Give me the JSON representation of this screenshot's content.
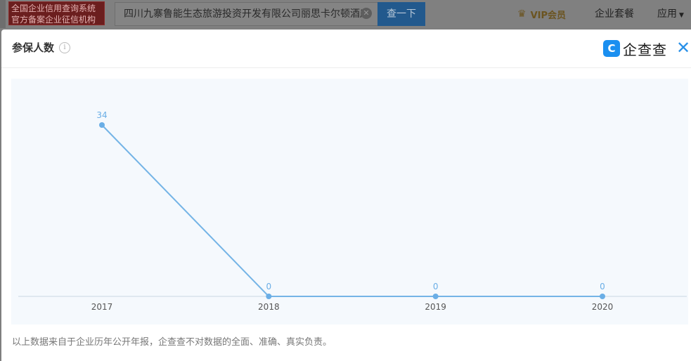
{
  "topbar": {
    "brand_line1": "全国企业信用查询系统",
    "brand_line2": "官方备案企业征信机构",
    "search_value": "四川九寨鲁能生态旅游投资开发有限公司丽思卡尔顿酒店",
    "search_button": "查一下",
    "vip_label": "VIP会员",
    "package_label": "企业套餐",
    "app_label": "应用"
  },
  "modal": {
    "title": "参保人数",
    "logo_text": "企查查",
    "footnote": "以上数据来自于企业历年公开年报，企查查不对数据的全面、准确、真实负责。"
  },
  "icons": {
    "info": "info-icon",
    "close": "close-icon",
    "clear": "clear-icon",
    "crown": "crown-icon",
    "logo": "qichacha-logo-icon"
  },
  "colors": {
    "line": "#74b4e6",
    "point": "#6aaee6",
    "label": "#6aaee6",
    "axis": "#c9d6e3",
    "tick_label": "#555555",
    "chart_bg": "#f5f9fd",
    "accent": "#1a8ff0"
  },
  "chart_data": {
    "type": "line",
    "title": "参保人数",
    "categories": [
      "2017",
      "2018",
      "2019",
      "2020"
    ],
    "series": [
      {
        "values": [
          34,
          0,
          0,
          0
        ]
      }
    ],
    "ylim": [
      0,
      34
    ],
    "grid": false,
    "data_labels": true
  }
}
